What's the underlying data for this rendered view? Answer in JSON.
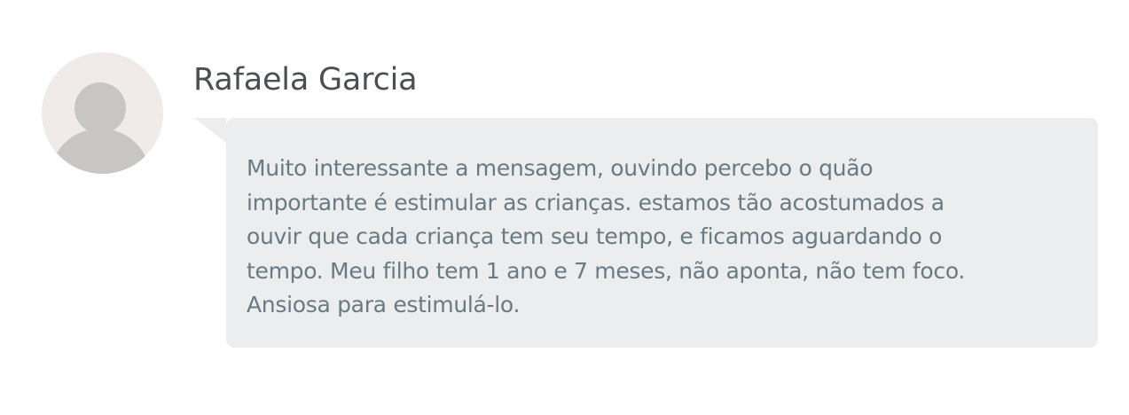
{
  "comment": {
    "author": {
      "name": "Rafaela Garcia",
      "avatar_icon": "default-user-avatar-icon"
    },
    "message": "Muito interessante a mensagem, ouvindo percebo o quão\nimportante é estimular as crianças. estamos tão acostumados a\nouvir que cada criança tem seu tempo, e ficamos aguardando o\ntempo. Meu filho tem 1 ano e 7 meses, não aponta, não tem foco.\nAnsiosa para estimulá-lo."
  },
  "colors": {
    "background": "#ffffff",
    "bubble_background": "#ecedef",
    "author_name": "#4a4f52",
    "message_text": "#6a7a82",
    "avatar_background": "#f0ebe9",
    "avatar_silhouette": "#c8c6c2"
  }
}
